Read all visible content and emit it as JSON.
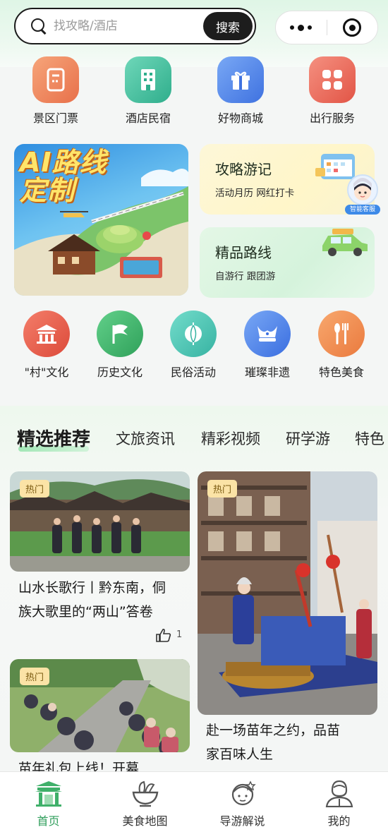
{
  "search": {
    "placeholder": "找攻略/酒店",
    "button_label": "搜索"
  },
  "quick_entries": [
    {
      "label": "景区门票",
      "icon": "ticket-icon",
      "color": "#ee8a5e"
    },
    {
      "label": "酒店民宿",
      "icon": "building-icon",
      "color": "#3fbf9d"
    },
    {
      "label": "好物商城",
      "icon": "gift-icon",
      "color": "#4f86e8"
    },
    {
      "label": "出行服务",
      "icon": "grid-icon",
      "color": "#ec6a5c"
    }
  ],
  "ai_card": {
    "title": "AI路线定制"
  },
  "guide_card": {
    "title": "攻略游记",
    "subtitle": "活动月历 网红打卡",
    "badge": "智能客服"
  },
  "route_card": {
    "title": "精品路线",
    "subtitle": "自游行 跟团游"
  },
  "culture_entries": [
    {
      "label": "\"村\"文化",
      "icon": "temple-icon",
      "color": "#e8624f"
    },
    {
      "label": "历史文化",
      "icon": "flag-icon",
      "color": "#3fb96c"
    },
    {
      "label": "民俗活动",
      "icon": "lantern-icon",
      "color": "#47c4b4"
    },
    {
      "label": "璀璨非遗",
      "icon": "silver-crown-icon",
      "color": "#4c87e6"
    },
    {
      "label": "特色美食",
      "icon": "utensils-icon",
      "color": "#f08a4e"
    }
  ],
  "tabs": [
    "精选推荐",
    "文旅资讯",
    "精彩视频",
    "研学游",
    "特色"
  ],
  "posts": [
    {
      "badge": "热门",
      "title_line1": "山水长歌行丨黔东南，侗",
      "title_line2": "族大歌里的“两山”答卷",
      "likes": "1"
    },
    {
      "badge": "热门",
      "title_line1": "赴一场苗年之约，品苗",
      "title_line2": "家百味人生"
    },
    {
      "badge": "热门",
      "title_line1": "苗年礼包上线！开幕"
    }
  ],
  "tabbar": [
    {
      "label": "首页",
      "icon": "home-gate-icon",
      "active": true
    },
    {
      "label": "美食地图",
      "icon": "food-bowl-icon",
      "active": false
    },
    {
      "label": "导游解说",
      "icon": "guide-avatar-icon",
      "active": false
    },
    {
      "label": "我的",
      "icon": "profile-icon",
      "active": false
    }
  ],
  "colors": {
    "accent_green": "#2f9e5b",
    "badge_bg": "#fbe3a6"
  }
}
